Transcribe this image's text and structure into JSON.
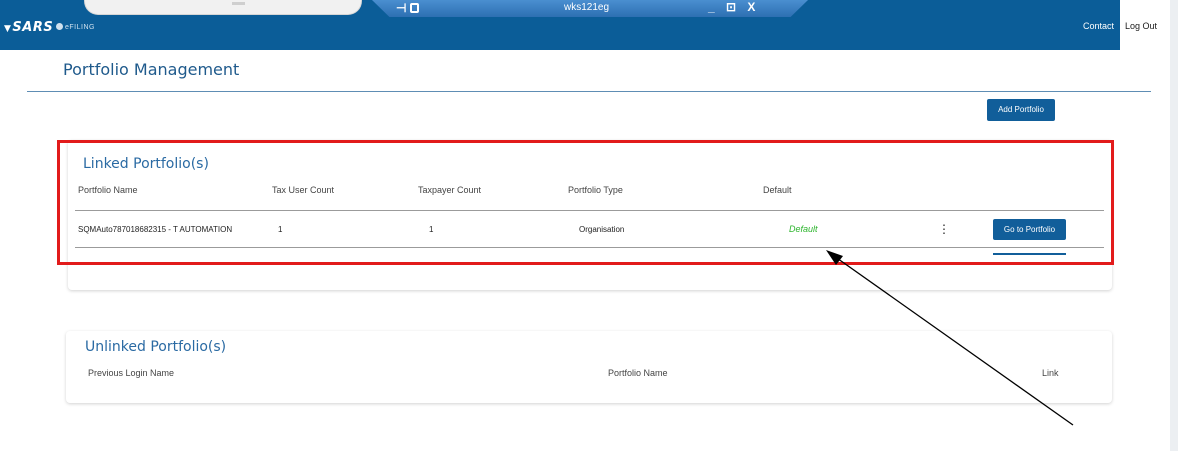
{
  "header": {
    "logo": "SARS",
    "efiling": "eFILING",
    "contact": "Contact",
    "logout": "Log Out",
    "remote_host": "wks121eg",
    "remote_pin": "⊣",
    "remote_controls": "_ ⊡ X"
  },
  "page": {
    "title": "Portfolio Management",
    "add_portfolio": "Add Portfolio"
  },
  "linked": {
    "title": "Linked Portfolio(s)",
    "columns": [
      "Portfolio Name",
      "Tax User Count",
      "Taxpayer Count",
      "Portfolio Type",
      "Default"
    ],
    "row": {
      "name": "SQMAuto787018682315 - T AUTOMATION",
      "tax_user_count": "1",
      "taxpayer_count": "1",
      "type": "Organisation",
      "default": "Default",
      "menu": "⋮",
      "go": "Go to Portfolio"
    }
  },
  "unlinked": {
    "title": "Unlinked Portfolio(s)",
    "columns": [
      "Previous Login Name",
      "Portfolio Name",
      "Link"
    ]
  },
  "colors": {
    "brand": "#0b5d98",
    "highlight": "#e21b1b",
    "default_text": "#2db52d"
  }
}
